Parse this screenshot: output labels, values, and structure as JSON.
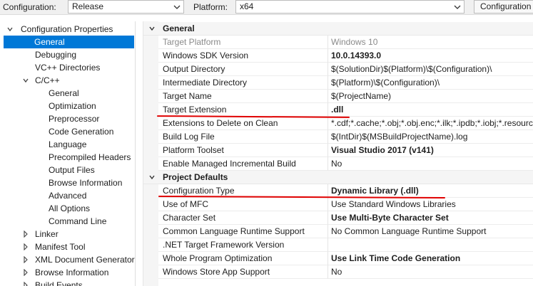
{
  "toolbar": {
    "configuration_label": "Configuration:",
    "configuration_value": "Release",
    "platform_label": "Platform:",
    "platform_value": "x64",
    "config_manager_button": "Configuration"
  },
  "tree": {
    "items": [
      {
        "label": "Configuration Properties"
      },
      {
        "label": "General"
      },
      {
        "label": "Debugging"
      },
      {
        "label": "VC++ Directories"
      },
      {
        "label": "C/C++"
      },
      {
        "label": "General"
      },
      {
        "label": "Optimization"
      },
      {
        "label": "Preprocessor"
      },
      {
        "label": "Code Generation"
      },
      {
        "label": "Language"
      },
      {
        "label": "Precompiled Headers"
      },
      {
        "label": "Output Files"
      },
      {
        "label": "Browse Information"
      },
      {
        "label": "Advanced"
      },
      {
        "label": "All Options"
      },
      {
        "label": "Command Line"
      },
      {
        "label": "Linker"
      },
      {
        "label": "Manifest Tool"
      },
      {
        "label": "XML Document Generator"
      },
      {
        "label": "Browse Information"
      },
      {
        "label": "Build Events"
      }
    ]
  },
  "grid": {
    "categories": [
      {
        "label": "General"
      },
      {
        "label": "Project Defaults"
      }
    ],
    "general": [
      {
        "name": "Target Platform",
        "value": "Windows 10"
      },
      {
        "name": "Windows SDK Version",
        "value": "10.0.14393.0"
      },
      {
        "name": "Output Directory",
        "value": "$(SolutionDir)$(Platform)\\$(Configuration)\\"
      },
      {
        "name": "Intermediate Directory",
        "value": "$(Platform)\\$(Configuration)\\"
      },
      {
        "name": "Target Name",
        "value": "$(ProjectName)"
      },
      {
        "name": "Target Extension",
        "value": ".dll"
      },
      {
        "name": "Extensions to Delete on Clean",
        "value": "*.cdf;*.cache;*.obj;*.obj.enc;*.ilk;*.ipdb;*.iobj;*.resources;*.tlb;*.tli;*.tlh"
      },
      {
        "name": "Build Log File",
        "value": "$(IntDir)$(MSBuildProjectName).log"
      },
      {
        "name": "Platform Toolset",
        "value": "Visual Studio 2017 (v141)"
      },
      {
        "name": "Enable Managed Incremental Build",
        "value": "No"
      }
    ],
    "defaults": [
      {
        "name": "Configuration Type",
        "value": "Dynamic Library (.dll)"
      },
      {
        "name": "Use of MFC",
        "value": "Use Standard Windows Libraries"
      },
      {
        "name": "Character Set",
        "value": "Use Multi-Byte Character Set"
      },
      {
        "name": "Common Language Runtime Support",
        "value": "No Common Language Runtime Support"
      },
      {
        "name": ".NET Target Framework Version",
        "value": ""
      },
      {
        "name": "Whole Program Optimization",
        "value": "Use Link Time Code Generation"
      },
      {
        "name": "Windows Store App Support",
        "value": "No"
      }
    ]
  },
  "colors": {
    "selection": "#0078d7",
    "annotation": "#e00000"
  }
}
